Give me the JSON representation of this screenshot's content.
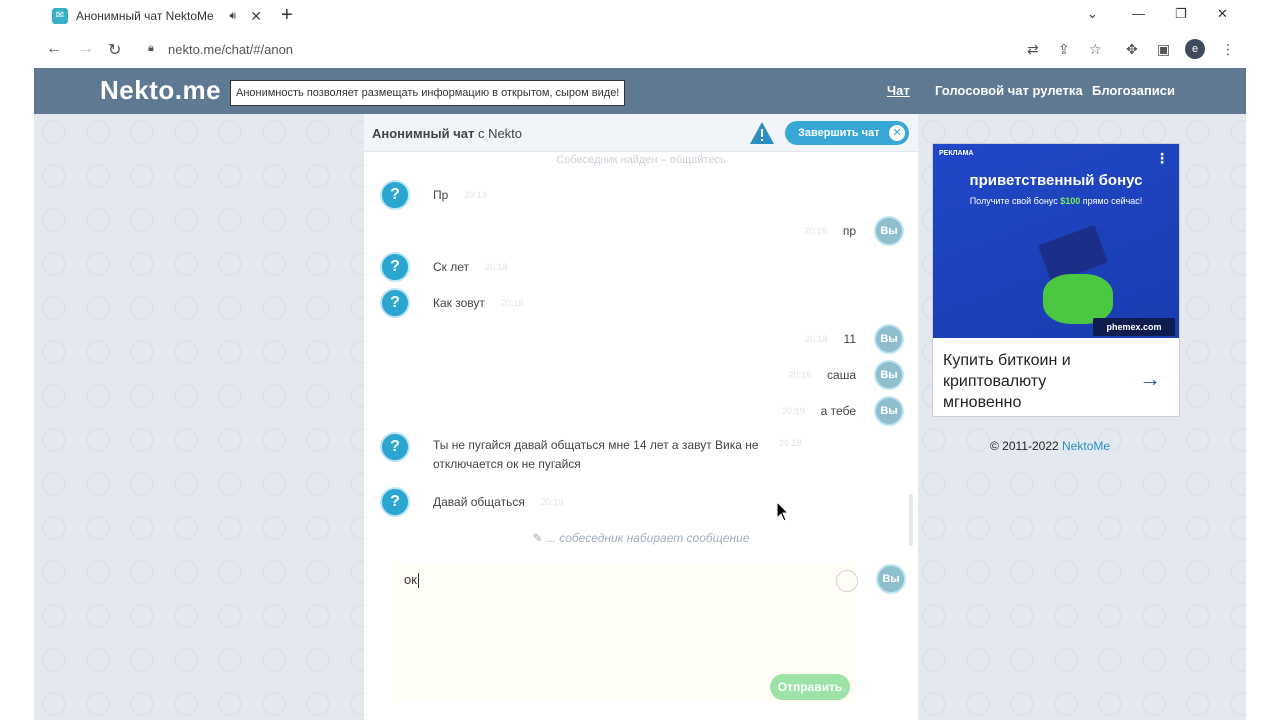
{
  "browser": {
    "tab_title": "Анонимный чат NektoMe",
    "tab_audio_icon": "speaker-icon",
    "url": "nekto.me/chat/#/anon",
    "profile_letter": "e"
  },
  "site": {
    "logo": "Nekto.me",
    "slogan": "Анонимность позволяет размещать информацию в открытом, сыром виде!",
    "nav": [
      {
        "label": "Чат"
      },
      {
        "label": "Голосовой чат рулетка"
      },
      {
        "label": "Блогозаписи"
      }
    ]
  },
  "chat": {
    "title_bold": "Анонимный чат",
    "title_rest": " с Nekto",
    "end_button": "Завершить чат",
    "found_notice": "Собеседник найден – общайтесь",
    "my_avatar": "Вы",
    "messages": [
      {
        "side": "them",
        "text": "Пр",
        "time": "20:13"
      },
      {
        "side": "me",
        "text": "пр",
        "time": "20:18"
      },
      {
        "side": "them",
        "text": "Ск лет",
        "time": "20:18"
      },
      {
        "side": "them",
        "text": "Как зовут",
        "time": "20:18"
      },
      {
        "side": "me",
        "text": "11",
        "time": "20:18"
      },
      {
        "side": "me",
        "text": "саша",
        "time": "20:18"
      },
      {
        "side": "me",
        "text": "а тебе",
        "time": "20:19"
      },
      {
        "side": "them",
        "text": "Ты не пугайся давай общаться мне 14 лет а завут Вика не отключается ок не пугайся",
        "time": "20:19"
      },
      {
        "side": "them",
        "text": "Давай общаться",
        "time": "20:19"
      }
    ],
    "typing": "... собеседник набирает сообщение",
    "input_value": "ок",
    "send_button": "Отправить"
  },
  "ad": {
    "label": "РЕКЛАМА",
    "title": "приветственный бонус",
    "sub_pre": "Получите свой бонус ",
    "sub_amount": "$100",
    "sub_post": " прямо сейчас!",
    "brand": "phemex.com",
    "cta": "Купить биткоин и криптовалюту мгновенно"
  },
  "footer": {
    "copyright": "© 2011-2022 ",
    "brand": "NektoMe"
  }
}
